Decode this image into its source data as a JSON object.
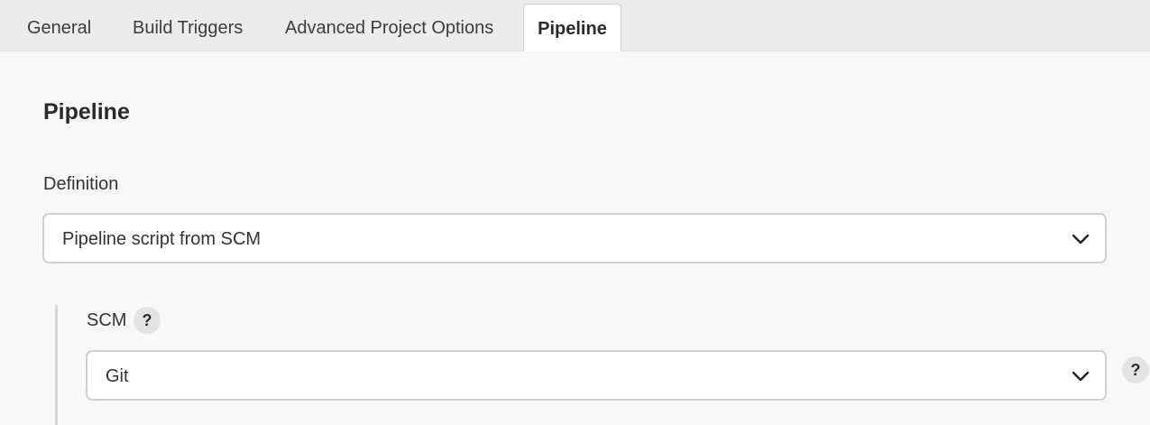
{
  "tabs": [
    {
      "label": "General",
      "active": false
    },
    {
      "label": "Build Triggers",
      "active": false
    },
    {
      "label": "Advanced Project Options",
      "active": false
    },
    {
      "label": "Pipeline",
      "active": true
    }
  ],
  "section": {
    "title": "Pipeline"
  },
  "definition": {
    "label": "Definition",
    "selected": "Pipeline script from SCM",
    "icon": "chevron-down-icon"
  },
  "scm": {
    "label": "SCM",
    "help_symbol": "?",
    "selected": "Git",
    "icon": "chevron-down-icon",
    "side_help_symbol": "?"
  },
  "colors": {
    "page_background": "#f8f8f8",
    "tabbar_background": "#ececec",
    "active_tab_background": "#ffffff",
    "select_border": "#ccd1d6",
    "help_background": "#e3e3e3"
  }
}
